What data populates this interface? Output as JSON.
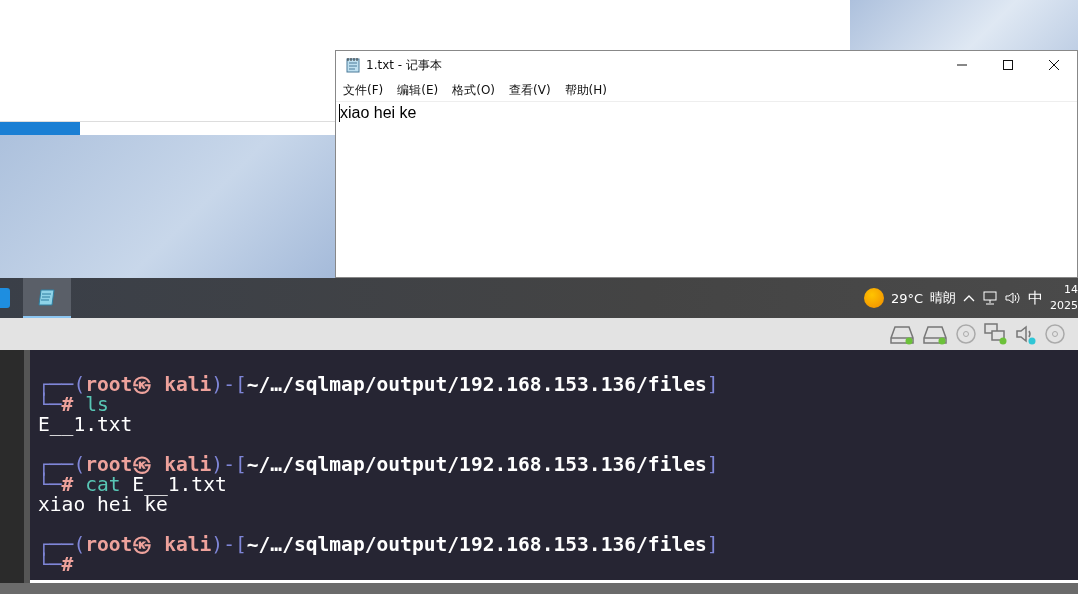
{
  "notepad": {
    "title": "1.txt - 记事本",
    "menu": [
      "文件(F)",
      "编辑(E)",
      "格式(O)",
      "查看(V)",
      "帮助(H)"
    ],
    "content": "xiao hei ke"
  },
  "taskbar": {
    "apps": [
      {
        "kind": "blue",
        "selected": false
      },
      {
        "kind": "notepad",
        "selected": true
      }
    ],
    "weather": {
      "temperature": "29°C",
      "condition": "晴朗"
    },
    "ime": "中",
    "clock": {
      "time": "14",
      "date": "2025"
    }
  },
  "vm_toolbar": {
    "devices": [
      {
        "kind": "drive",
        "active": true
      },
      {
        "kind": "drive",
        "active": true
      },
      {
        "kind": "disc",
        "active": false
      },
      {
        "kind": "network",
        "active": true
      },
      {
        "kind": "sound",
        "active": true
      },
      {
        "kind": "disc",
        "active": false
      }
    ]
  },
  "terminal": {
    "lines": [
      {
        "kind": "blank"
      },
      {
        "kind": "prompt",
        "segments": [
          {
            "text": "┌──(",
            "kind": "frame"
          },
          {
            "text": "root㉿ kali",
            "kind": "user"
          },
          {
            "text": ")-[",
            "kind": "frame"
          },
          {
            "text": "~/…/sqlmap/output/192.168.153.136/files",
            "kind": "path"
          },
          {
            "text": "]",
            "kind": "frame"
          }
        ]
      },
      {
        "kind": "prompt",
        "segments": [
          {
            "text": "└─",
            "kind": "frame"
          },
          {
            "text": "#",
            "kind": "user"
          },
          {
            "text": " ls",
            "kind": "command"
          }
        ]
      },
      {
        "kind": "output",
        "segments": [
          {
            "text": "E__1.txt",
            "kind": "plain"
          }
        ]
      },
      {
        "kind": "blank"
      },
      {
        "kind": "prompt",
        "segments": [
          {
            "text": "┌──(",
            "kind": "frame"
          },
          {
            "text": "root㉿ kali",
            "kind": "user"
          },
          {
            "text": ")-[",
            "kind": "frame"
          },
          {
            "text": "~/…/sqlmap/output/192.168.153.136/files",
            "kind": "path"
          },
          {
            "text": "]",
            "kind": "frame"
          }
        ]
      },
      {
        "kind": "prompt",
        "segments": [
          {
            "text": "└─",
            "kind": "frame"
          },
          {
            "text": "#",
            "kind": "user"
          },
          {
            "text": " cat",
            "kind": "command"
          },
          {
            "text": " E__1.txt",
            "kind": "plain"
          }
        ]
      },
      {
        "kind": "output",
        "segments": [
          {
            "text": "xiao hei ke",
            "kind": "plain"
          }
        ]
      },
      {
        "kind": "blank"
      },
      {
        "kind": "prompt",
        "segments": [
          {
            "text": "┌──(",
            "kind": "frame"
          },
          {
            "text": "root㉿ kali",
            "kind": "user"
          },
          {
            "text": ")-[",
            "kind": "frame"
          },
          {
            "text": "~/…/sqlmap/output/192.168.153.136/files",
            "kind": "path"
          },
          {
            "text": "]",
            "kind": "frame"
          }
        ]
      },
      {
        "kind": "prompt",
        "segments": [
          {
            "text": "└─",
            "kind": "frame"
          },
          {
            "text": "#",
            "kind": "user"
          }
        ]
      }
    ]
  }
}
